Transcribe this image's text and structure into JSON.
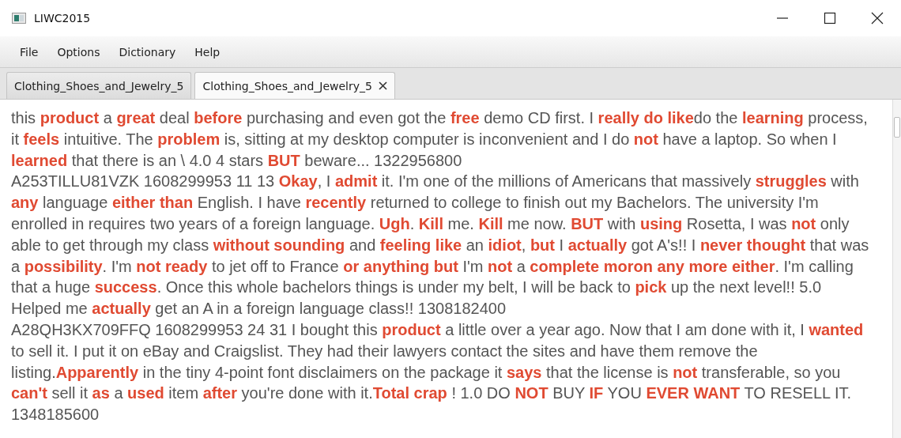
{
  "window": {
    "title": "LIWC2015"
  },
  "menu": [
    "File",
    "Options",
    "Dictionary",
    "Help"
  ],
  "tabs": [
    {
      "label": "Clothing_Shoes_and_Jewelry_5",
      "selected": false
    },
    {
      "label": "Clothing_Shoes_and_Jewelry_5",
      "selected": true
    }
  ],
  "text_lines": [
    "this **product** a **great** deal **before** purchasing and even got the **free** demo CD first. I **really do like**do the **learning** process,",
    "it **feels** intuitive. The **problem** is, sitting at my desktop computer is inconvenient and I do **not** have a laptop. So when I",
    "**learned** that there is an \\ 4.0 4 stars **BUT** beware... 1322956800",
    "A253TILLU81VZK 1608299953 11 13 **Okay**, I **admit** it. I'm one of the millions of Americans that massively **struggles** with",
    "**any** language **either than** English. I have **recently** returned to college to finish out my Bachelors. The university I'm",
    "enrolled in requires two years of a foreign language. **Ugh**. **Kill** me. **Kill** me now. **BUT** with **using** Rosetta, I was **not** only",
    "able to get through my class **without sounding** and **feeling like** an **idiot**, **but** I **actually** got A's!! I **never thought** that was",
    "a **possibility**. I'm **not ready** to jet off to France **or anything but** I'm **not** a **complete moron any more either**. I'm calling",
    "that a huge **success**. Once this whole bachelors things is under my belt, I will be back to **pick** up the next level!! 5.0",
    "Helped me **actually** get an A in a foreign language class!! 1308182400",
    "A28QH3KX709FFQ 1608299953 24 31 I bought this **product** a little over a year ago. Now that I am done with it, I **wanted**",
    "to sell it. I put it on eBay and Craigslist. They had their lawyers contact the sites and have them remove the",
    "listing.**Apparently** in the tiny 4-point font disclaimers on the package it **says** that the license is **not** transferable, so you",
    "**can't** sell it **as** a **used** item **after** you're done with it.**Total crap** ! 1.0 DO **NOT** BUY **IF** YOU **EVER WANT** TO RESELL IT.",
    "1348185600"
  ]
}
